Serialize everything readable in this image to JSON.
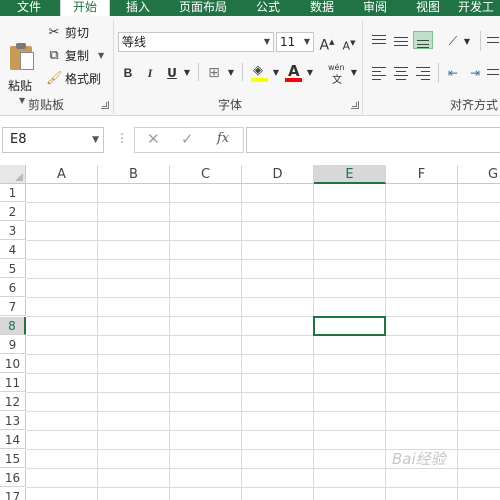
{
  "ribbon_tabs": [
    {
      "label": "文件",
      "active": false
    },
    {
      "label": "开始",
      "active": true
    },
    {
      "label": "插入",
      "active": false
    },
    {
      "label": "页面布局",
      "active": false
    },
    {
      "label": "公式",
      "active": false
    },
    {
      "label": "数据",
      "active": false
    },
    {
      "label": "审阅",
      "active": false
    },
    {
      "label": "视图",
      "active": false
    },
    {
      "label": "开发工",
      "active": false
    }
  ],
  "clipboard": {
    "paste_label": "粘贴",
    "cut_label": "剪切",
    "copy_label": "复制",
    "format_painter_label": "格式刷",
    "group_label": "剪贴板"
  },
  "font": {
    "font_name": "等线",
    "font_size": "11",
    "bold": "B",
    "italic": "I",
    "underline": "U",
    "phonetic_top": "wén",
    "phonetic_bottom": "文",
    "group_label": "字体"
  },
  "alignment": {
    "group_label": "对齐方式"
  },
  "formula_bar": {
    "name_box_value": "E8",
    "formula_value": ""
  },
  "grid": {
    "columns": [
      "A",
      "B",
      "C",
      "D",
      "E",
      "F",
      "G"
    ],
    "rows": [
      "1",
      "2",
      "3",
      "4",
      "5",
      "6",
      "7",
      "8",
      "9",
      "10",
      "11",
      "12",
      "13",
      "14",
      "15",
      "16",
      "17"
    ],
    "selected_column": "E",
    "selected_row": "8"
  },
  "watermark": "Bai经验",
  "colors": {
    "excel_green": "#217346",
    "fill_yellow": "#ffff00",
    "font_red": "#ff0000"
  }
}
